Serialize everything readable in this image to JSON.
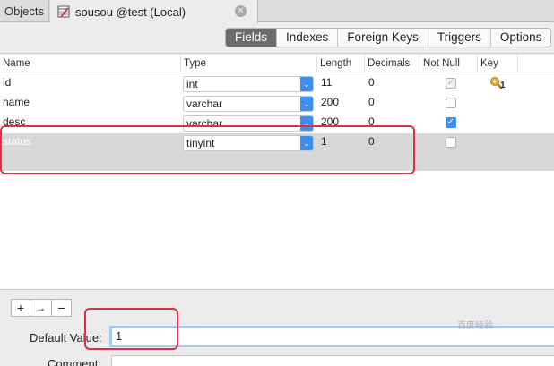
{
  "tabs": {
    "objects": "Objects",
    "active": "sousou @test (Local)"
  },
  "toolbar": {
    "segments": [
      "Fields",
      "Indexes",
      "Foreign Keys",
      "Triggers",
      "Options"
    ],
    "active": "Fields"
  },
  "table": {
    "headers": [
      "Name",
      "Type",
      "Length",
      "Decimals",
      "Not Null",
      "Key"
    ],
    "rows": [
      {
        "name": "id",
        "type": "int",
        "length": "11",
        "decimals": "0",
        "not_null": true,
        "key": "1"
      },
      {
        "name": "name",
        "type": "varchar",
        "length": "200",
        "decimals": "0",
        "not_null": false,
        "key": ""
      },
      {
        "name": "desc",
        "type": "varchar",
        "length": "200",
        "decimals": "0",
        "not_null": true,
        "key": ""
      },
      {
        "name": "status",
        "type": "tinyint",
        "length": "1",
        "decimals": "0",
        "not_null": false,
        "key": ""
      }
    ]
  },
  "bottom": {
    "add": "+",
    "insert": "→",
    "remove": "−"
  },
  "properties": {
    "default_value_label": "Default Value:",
    "default_value": "1",
    "comment_label": "Comment:"
  },
  "watermark": "百度经验",
  "colors": {
    "accent": "#3d8ef0",
    "highlight": "#e0303f",
    "selected_row": "#d7d7d7"
  }
}
